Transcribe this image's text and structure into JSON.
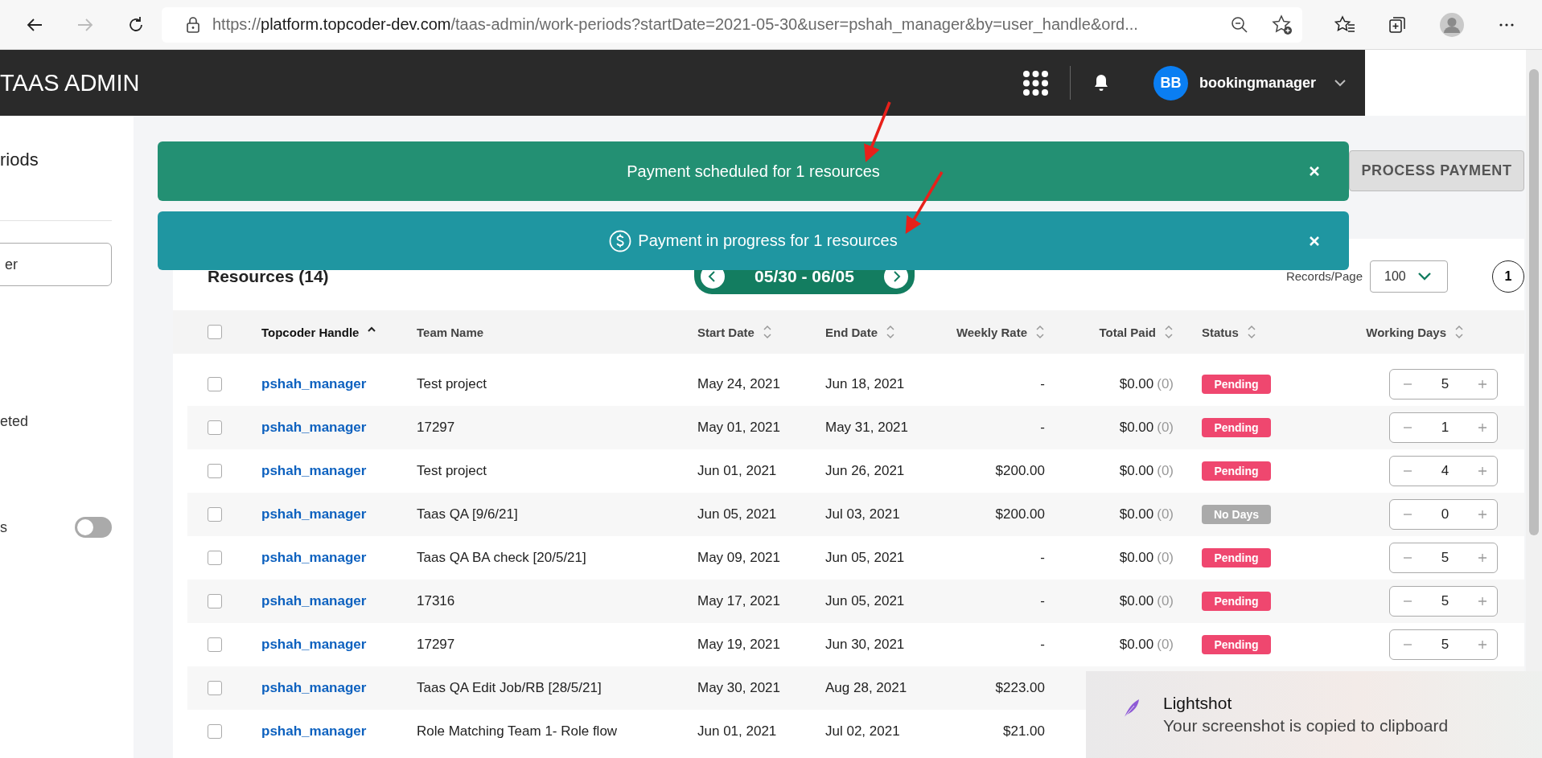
{
  "browser": {
    "url_scheme": "https://",
    "url_host": "platform.topcoder-dev.com",
    "url_path": "/taas-admin/work-periods?startDate=2021-05-30&user=pshah_manager&by=user_handle&ord..."
  },
  "header": {
    "title": "TAAS ADMIN",
    "user_initials": "BB",
    "user_name": "bookingmanager"
  },
  "sidebar": {
    "title": "riods",
    "search": {
      "value": "er"
    },
    "items": [
      {
        "label": "eted"
      }
    ],
    "toggle": {
      "label": "s",
      "on": false
    }
  },
  "notifications": [
    {
      "kind": "success",
      "message": "Payment scheduled for 1 resources"
    },
    {
      "kind": "info",
      "message": "Payment in progress for 1 resources"
    }
  ],
  "process_button": "PROCESS PAYMENT",
  "resources": {
    "title": "Resources (14)",
    "period": "05/30 - 06/05",
    "records_label": "Records/Page",
    "records_per_page": "100",
    "page": "1"
  },
  "table": {
    "select_all_checked": false,
    "columns": [
      {
        "label": "Topcoder Handle",
        "sortable": true,
        "sorted": true
      },
      {
        "label": "Team Name",
        "sortable": false,
        "sorted": false
      },
      {
        "label": "Start Date",
        "sortable": true,
        "sorted": false
      },
      {
        "label": "End Date",
        "sortable": true,
        "sorted": false
      },
      {
        "label": "Weekly Rate",
        "sortable": true,
        "sorted": false
      },
      {
        "label": "Total Paid",
        "sortable": true,
        "sorted": false
      },
      {
        "label": "Status",
        "sortable": true,
        "sorted": false
      },
      {
        "label": "Working Days",
        "sortable": true,
        "sorted": false
      }
    ],
    "rows": [
      {
        "checked": false,
        "handle": "pshah_manager",
        "team": "Test project",
        "start": "May 24, 2021",
        "end": "Jun 18, 2021",
        "rate": "-",
        "paid": "$0.00",
        "paid_count": "(0)",
        "status": {
          "label": "Pending",
          "color": "#ef476f"
        },
        "days": "5"
      },
      {
        "checked": false,
        "handle": "pshah_manager",
        "team": "17297",
        "start": "May 01, 2021",
        "end": "May 31, 2021",
        "rate": "-",
        "paid": "$0.00",
        "paid_count": "(0)",
        "status": {
          "label": "Pending",
          "color": "#ef476f"
        },
        "days": "1"
      },
      {
        "checked": false,
        "handle": "pshah_manager",
        "team": "Test project",
        "start": "Jun 01, 2021",
        "end": "Jun 26, 2021",
        "rate": "$200.00",
        "paid": "$0.00",
        "paid_count": "(0)",
        "status": {
          "label": "Pending",
          "color": "#ef476f"
        },
        "days": "4"
      },
      {
        "checked": false,
        "handle": "pshah_manager",
        "team": "Taas QA [9/6/21]",
        "start": "Jun 05, 2021",
        "end": "Jul 03, 2021",
        "rate": "$200.00",
        "paid": "$0.00",
        "paid_count": "(0)",
        "status": {
          "label": "No Days",
          "color": "#aaaaaa"
        },
        "days": "0"
      },
      {
        "checked": false,
        "handle": "pshah_manager",
        "team": "Taas QA BA check [20/5/21]",
        "start": "May 09, 2021",
        "end": "Jun 05, 2021",
        "rate": "-",
        "paid": "$0.00",
        "paid_count": "(0)",
        "status": {
          "label": "Pending",
          "color": "#ef476f"
        },
        "days": "5"
      },
      {
        "checked": false,
        "handle": "pshah_manager",
        "team": "17316",
        "start": "May 17, 2021",
        "end": "Jun 05, 2021",
        "rate": "-",
        "paid": "$0.00",
        "paid_count": "(0)",
        "status": {
          "label": "Pending",
          "color": "#ef476f"
        },
        "days": "5"
      },
      {
        "checked": false,
        "handle": "pshah_manager",
        "team": "17297",
        "start": "May 19, 2021",
        "end": "Jun 30, 2021",
        "rate": "-",
        "paid": "$0.00",
        "paid_count": "(0)",
        "status": {
          "label": "Pending",
          "color": "#ef476f"
        },
        "days": "5"
      },
      {
        "checked": false,
        "handle": "pshah_manager",
        "team": "Taas QA Edit Job/RB [28/5/21]",
        "start": "May 30, 2021",
        "end": "Aug 28, 2021",
        "rate": "$223.00"
      },
      {
        "checked": false,
        "handle": "pshah_manager",
        "team": "Role Matching Team 1- Role flow",
        "start": "Jun 01, 2021",
        "end": "Jul 02, 2021",
        "rate": "$21.00"
      }
    ]
  },
  "toast": {
    "title": "Lightshot",
    "message": "Your screenshot is copied to clipboard"
  }
}
